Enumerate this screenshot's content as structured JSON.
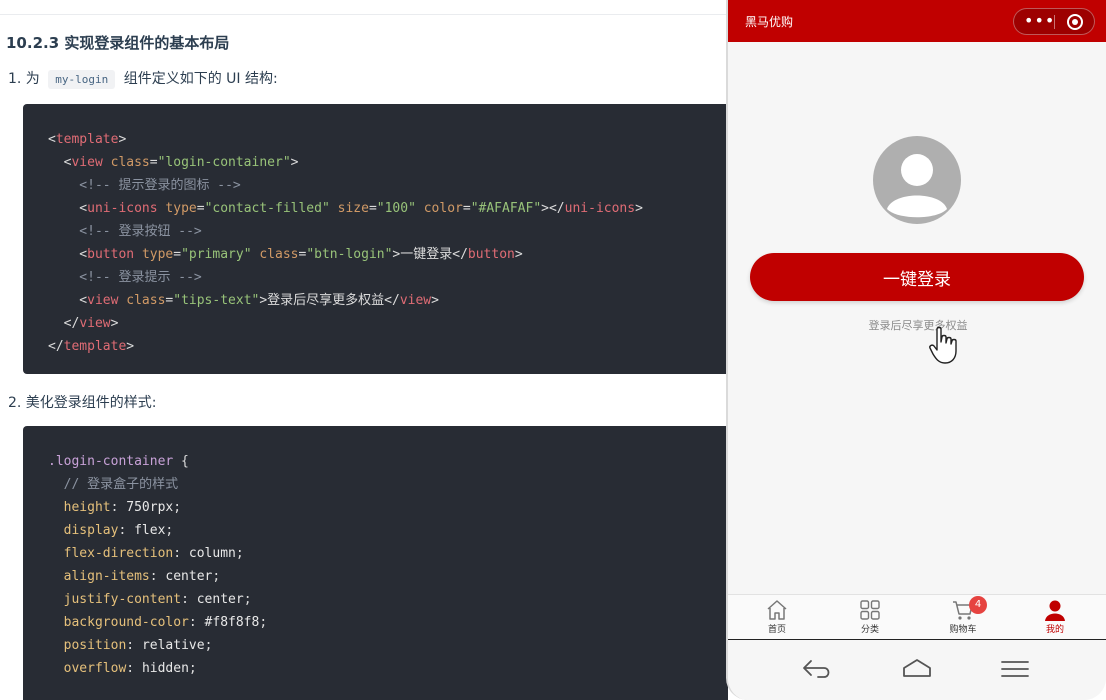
{
  "doc": {
    "heading": "10.2.3 实现登录组件的基本布局",
    "step1": {
      "prefix": "1. 为",
      "code": "my-login",
      "suffix": "组件定义如下的 UI 结构:"
    },
    "step2": {
      "text": "2. 美化登录组件的样式:"
    },
    "code1": [
      [
        [
          "tk-punc",
          "<"
        ],
        [
          "tk-tag",
          "template"
        ],
        [
          "tk-punc",
          ">"
        ]
      ],
      [
        [
          "tk-punc",
          "  <"
        ],
        [
          "tk-tag",
          "view"
        ],
        [
          "tk-punc",
          " "
        ],
        [
          "tk-attr",
          "class"
        ],
        [
          "tk-punc",
          "="
        ],
        [
          "tk-str",
          "\"login-container\""
        ],
        [
          "tk-punc",
          ">"
        ]
      ],
      [
        [
          "tk-cmt",
          "    <!-- 提示登录的图标 -->"
        ]
      ],
      [
        [
          "tk-punc",
          "    <"
        ],
        [
          "tk-tag",
          "uni-icons"
        ],
        [
          "tk-punc",
          " "
        ],
        [
          "tk-attr",
          "type"
        ],
        [
          "tk-punc",
          "="
        ],
        [
          "tk-str",
          "\"contact-filled\""
        ],
        [
          "tk-punc",
          " "
        ],
        [
          "tk-attr",
          "size"
        ],
        [
          "tk-punc",
          "="
        ],
        [
          "tk-str",
          "\"100\""
        ],
        [
          "tk-punc",
          " "
        ],
        [
          "tk-attr",
          "color"
        ],
        [
          "tk-punc",
          "="
        ],
        [
          "tk-str",
          "\"#AFAFAF\""
        ],
        [
          "tk-punc",
          "></"
        ],
        [
          "tk-tag",
          "uni-icons"
        ],
        [
          "tk-punc",
          ">"
        ]
      ],
      [
        [
          "tk-cmt",
          "    <!-- 登录按钮 -->"
        ]
      ],
      [
        [
          "tk-punc",
          "    <"
        ],
        [
          "tk-tag",
          "button"
        ],
        [
          "tk-punc",
          " "
        ],
        [
          "tk-attr",
          "type"
        ],
        [
          "tk-punc",
          "="
        ],
        [
          "tk-str",
          "\"primary\""
        ],
        [
          "tk-punc",
          " "
        ],
        [
          "tk-attr",
          "class"
        ],
        [
          "tk-punc",
          "="
        ],
        [
          "tk-str",
          "\"btn-login\""
        ],
        [
          "tk-punc",
          ">一键登录</"
        ],
        [
          "tk-tag",
          "button"
        ],
        [
          "tk-punc",
          ">"
        ]
      ],
      [
        [
          "tk-cmt",
          "    <!-- 登录提示 -->"
        ]
      ],
      [
        [
          "tk-punc",
          "    <"
        ],
        [
          "tk-tag",
          "view"
        ],
        [
          "tk-punc",
          " "
        ],
        [
          "tk-attr",
          "class"
        ],
        [
          "tk-punc",
          "="
        ],
        [
          "tk-str",
          "\"tips-text\""
        ],
        [
          "tk-punc",
          ">登录后尽享更多权益</"
        ],
        [
          "tk-tag",
          "view"
        ],
        [
          "tk-punc",
          ">"
        ]
      ],
      [
        [
          "tk-punc",
          "  </"
        ],
        [
          "tk-tag",
          "view"
        ],
        [
          "tk-punc",
          ">"
        ]
      ],
      [
        [
          "tk-punc",
          "</"
        ],
        [
          "tk-tag",
          "template"
        ],
        [
          "tk-punc",
          ">"
        ]
      ]
    ],
    "code2": [
      [
        [
          "tk-sel",
          ".login-container"
        ],
        [
          "tk-punc",
          " {"
        ]
      ],
      [
        [
          "tk-cmt",
          "  // 登录盒子的样式"
        ]
      ],
      [
        [
          "tk-prop",
          "  height"
        ],
        [
          "tk-punc",
          ": "
        ],
        [
          "tk-val",
          "750rpx"
        ],
        [
          "tk-punc",
          ";"
        ]
      ],
      [
        [
          "tk-prop",
          "  display"
        ],
        [
          "tk-punc",
          ": "
        ],
        [
          "tk-val",
          "flex"
        ],
        [
          "tk-punc",
          ";"
        ]
      ],
      [
        [
          "tk-prop",
          "  flex-direction"
        ],
        [
          "tk-punc",
          ": "
        ],
        [
          "tk-val",
          "column"
        ],
        [
          "tk-punc",
          ";"
        ]
      ],
      [
        [
          "tk-prop",
          "  align-items"
        ],
        [
          "tk-punc",
          ": "
        ],
        [
          "tk-val",
          "center"
        ],
        [
          "tk-punc",
          ";"
        ]
      ],
      [
        [
          "tk-prop",
          "  justify-content"
        ],
        [
          "tk-punc",
          ": "
        ],
        [
          "tk-val",
          "center"
        ],
        [
          "tk-punc",
          ";"
        ]
      ],
      [
        [
          "tk-prop",
          "  background-color"
        ],
        [
          "tk-punc",
          ": "
        ],
        [
          "tk-val",
          "#f8f8f8"
        ],
        [
          "tk-punc",
          ";"
        ]
      ],
      [
        [
          "tk-prop",
          "  position"
        ],
        [
          "tk-punc",
          ": "
        ],
        [
          "tk-val",
          "relative"
        ],
        [
          "tk-punc",
          ";"
        ]
      ],
      [
        [
          "tk-prop",
          "  overflow"
        ],
        [
          "tk-punc",
          ": "
        ],
        [
          "tk-val",
          "hidden"
        ],
        [
          "tk-punc",
          ";"
        ]
      ]
    ]
  },
  "phone": {
    "nav_title": "黑马优购",
    "capsule_more": "•••",
    "login_button": "一键登录",
    "tips_text": "登录后尽享更多权益",
    "tabs": [
      {
        "label": "首页",
        "icon": "home-icon"
      },
      {
        "label": "分类",
        "icon": "category-grid-icon"
      },
      {
        "label": "购物车",
        "icon": "cart-icon",
        "badge": "4"
      },
      {
        "label": "我的",
        "icon": "user-icon",
        "active": true
      }
    ],
    "colors": {
      "brand": "#c00000",
      "avatar": "#AFAFAF",
      "badge": "#e64340",
      "page_bg": "#f6f6f6"
    }
  }
}
